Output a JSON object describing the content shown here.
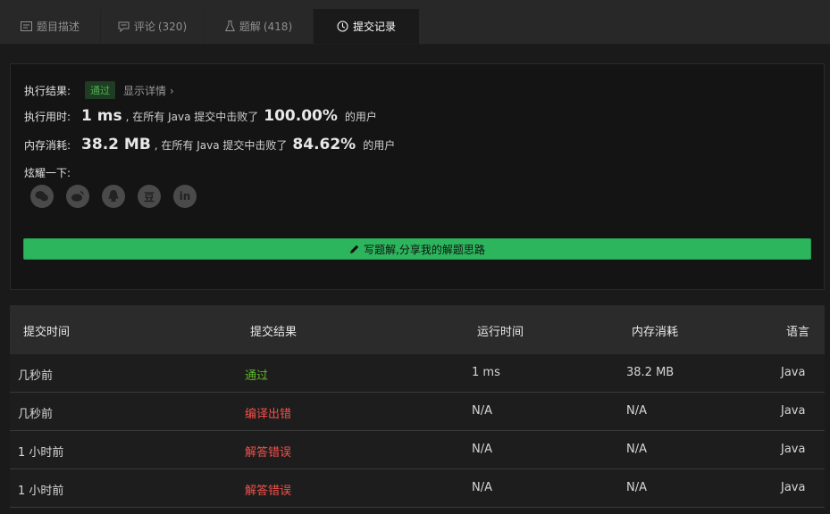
{
  "tabs": [
    {
      "label": "题目描述",
      "count": ""
    },
    {
      "label": "评论",
      "count": "(320)"
    },
    {
      "label": "题解",
      "count": "(418)"
    },
    {
      "label": "提交记录",
      "count": ""
    }
  ],
  "result": {
    "status_label": "执行结果:",
    "status_value": "通过",
    "details_link": "显示详情 ›",
    "runtime_label": "执行用时:",
    "runtime_value": "1 ms",
    "runtime_mid": ", 在所有 Java 提交中击败了",
    "runtime_pct": "100.00%",
    "runtime_suffix": "的用户",
    "memory_label": "内存消耗:",
    "memory_value": "38.2 MB",
    "memory_mid": ", 在所有 Java 提交中击败了",
    "memory_pct": "84.62%",
    "memory_suffix": "的用户",
    "share_label": "炫耀一下:",
    "social_icons": [
      "wechat-icon",
      "weibo-icon",
      "qq-icon",
      "douban-icon",
      "linkedin-icon"
    ],
    "douban_glyph": "豆",
    "linkedin_glyph": "in",
    "write_button": "写题解,分享我的解题思路"
  },
  "table": {
    "headers": [
      "提交时间",
      "提交结果",
      "运行时间",
      "内存消耗",
      "语言"
    ],
    "rows": [
      {
        "time": "几秒前",
        "result": "通过",
        "runtime": "1 ms",
        "memory": "38.2 MB",
        "lang": "Java",
        "status": "ok"
      },
      {
        "time": "几秒前",
        "result": "编译出错",
        "runtime": "N/A",
        "memory": "N/A",
        "lang": "Java",
        "status": "err"
      },
      {
        "time": "1 小时前",
        "result": "解答错误",
        "runtime": "N/A",
        "memory": "N/A",
        "lang": "Java",
        "status": "err"
      },
      {
        "time": "1 小时前",
        "result": "解答错误",
        "runtime": "N/A",
        "memory": "N/A",
        "lang": "Java",
        "status": "err"
      }
    ]
  },
  "colors": {
    "accent": "#2db55d",
    "ok": "#5cb82c",
    "error": "#f2504b"
  }
}
